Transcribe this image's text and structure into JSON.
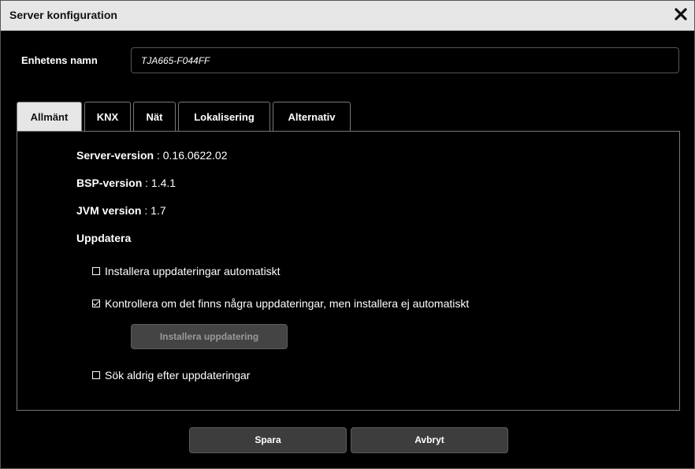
{
  "dialog": {
    "title": "Server konfiguration"
  },
  "device_name": {
    "label": "Enhetens namn",
    "value": "TJA665-F044FF"
  },
  "tabs": [
    {
      "label": "Allmänt",
      "active": true
    },
    {
      "label": "KNX",
      "active": false
    },
    {
      "label": "Nät",
      "active": false
    },
    {
      "label": "Lokalisering",
      "active": false
    },
    {
      "label": "Alternativ",
      "active": false
    }
  ],
  "general": {
    "server_version_label": "Server-version",
    "server_version_value": " : 0.16.0622.02",
    "bsp_version_label": "BSP-version",
    "bsp_version_value": " : 1.4.1",
    "jvm_version_label": "JVM version",
    "jvm_version_value": " : 1.7",
    "update_heading": "Uppdatera",
    "options": [
      {
        "label": "Installera uppdateringar automatiskt",
        "checked": false
      },
      {
        "label": "Kontrollera om det finns några uppdateringar, men installera ej automatiskt",
        "checked": true
      },
      {
        "label": "Sök aldrig efter uppdateringar",
        "checked": false
      }
    ],
    "install_update_button": "Installera uppdatering"
  },
  "footer": {
    "save_label": "Spara",
    "cancel_label": "Avbryt"
  },
  "icons": {
    "close": "close-icon"
  }
}
